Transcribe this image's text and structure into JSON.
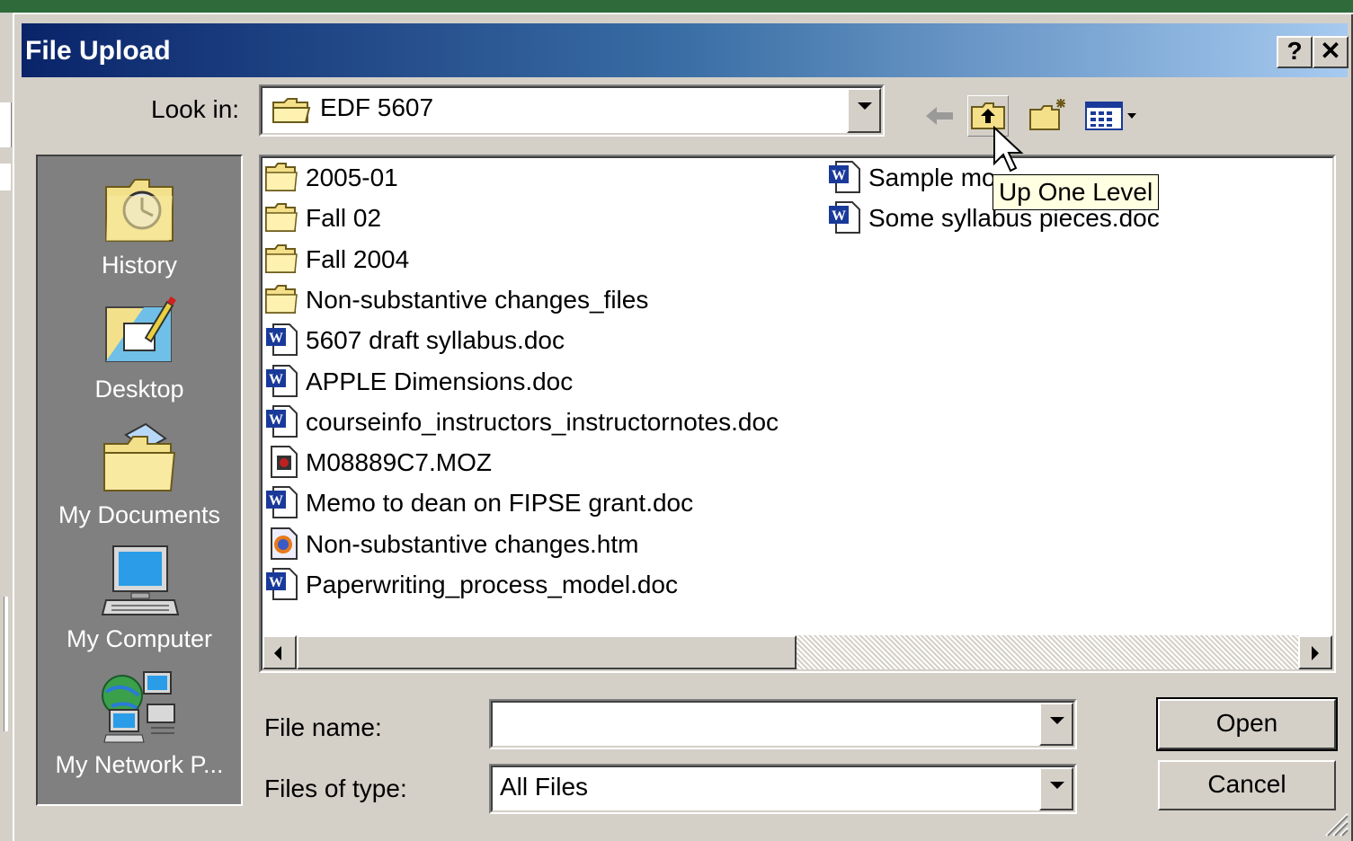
{
  "window": {
    "title": "File Upload",
    "help_label": "?",
    "close_label": "✕"
  },
  "look_in": {
    "label": "Look in:",
    "value": "EDF 5607"
  },
  "toolbar": {
    "back": "back-arrow-icon",
    "up": "up-one-level-icon",
    "new_folder": "new-folder-icon",
    "views": "view-menu-icon"
  },
  "tooltip": {
    "text": "Up One Level"
  },
  "places": [
    {
      "label": "History",
      "icon": "history-icon"
    },
    {
      "label": "Desktop",
      "icon": "desktop-icon"
    },
    {
      "label": "My Documents",
      "icon": "my-documents-icon"
    },
    {
      "label": "My Computer",
      "icon": "my-computer-icon"
    },
    {
      "label": "My Network P...",
      "icon": "my-network-places-icon"
    }
  ],
  "files": [
    {
      "name": "2005-01",
      "type": "folder"
    },
    {
      "name": "Fall 02",
      "type": "folder"
    },
    {
      "name": "Fall 2004",
      "type": "folder"
    },
    {
      "name": "Non-substantive changes_files",
      "type": "folder"
    },
    {
      "name": "5607 draft syllabus.doc",
      "type": "doc"
    },
    {
      "name": "APPLE Dimensions.doc",
      "type": "doc"
    },
    {
      "name": "courseinfo_instructors_instructornotes.doc",
      "type": "doc"
    },
    {
      "name": "M08889C7.MOZ",
      "type": "moz"
    },
    {
      "name": "Memo to dean on FIPSE grant.doc",
      "type": "doc"
    },
    {
      "name": "Non-substantive changes.htm",
      "type": "htm"
    },
    {
      "name": "Paperwriting_process_model.doc",
      "type": "doc"
    },
    {
      "name": "Sample mo",
      "type": "doc"
    },
    {
      "name": "Some syllabus pieces.doc",
      "type": "doc"
    }
  ],
  "file_name": {
    "label": "File name:",
    "value": ""
  },
  "files_of_type": {
    "label": "Files of type:",
    "value": "All Files"
  },
  "buttons": {
    "open": "Open",
    "cancel": "Cancel"
  }
}
